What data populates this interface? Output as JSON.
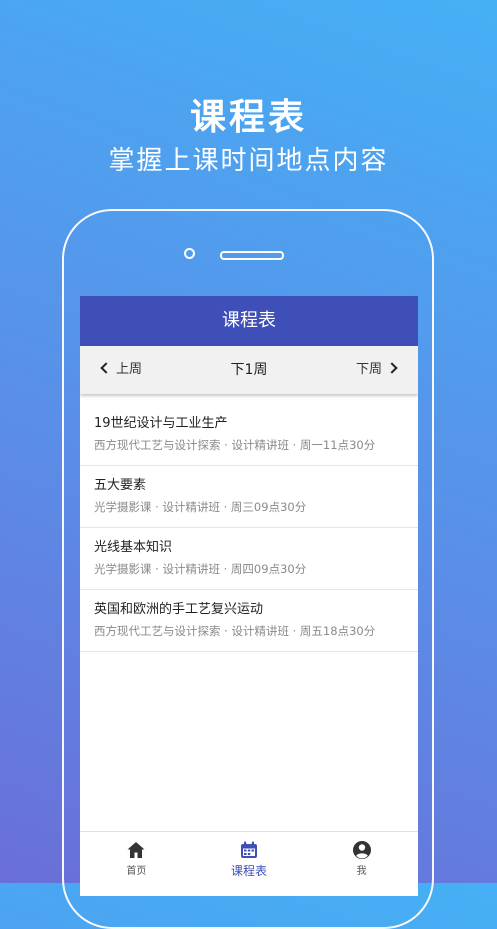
{
  "promo": {
    "title": "课程表",
    "subtitle": "掌握上课时间地点内容"
  },
  "app": {
    "header_title": "课程表",
    "week_nav": {
      "prev": "上周",
      "current": "下1周",
      "next": "下周"
    },
    "courses": [
      {
        "title": "19世纪设计与工业生产",
        "detail": "西方现代工艺与设计探索 · 设计精讲班 · 周一11点30分"
      },
      {
        "title": "五大要素",
        "detail": "光学摄影课 · 设计精讲班 · 周三09点30分"
      },
      {
        "title": "光线基本知识",
        "detail": "光学摄影课 · 设计精讲班 · 周四09点30分"
      },
      {
        "title": "英国和欧洲的手工艺复兴运动",
        "detail": "西方现代工艺与设计探索 · 设计精讲班 · 周五18点30分"
      }
    ],
    "tabs": [
      {
        "label": "首页",
        "icon": "home-icon"
      },
      {
        "label": "课程表",
        "icon": "calendar-icon",
        "active": true
      },
      {
        "label": "我",
        "icon": "user-icon"
      }
    ],
    "colors": {
      "accent": "#3e4fb8"
    }
  }
}
